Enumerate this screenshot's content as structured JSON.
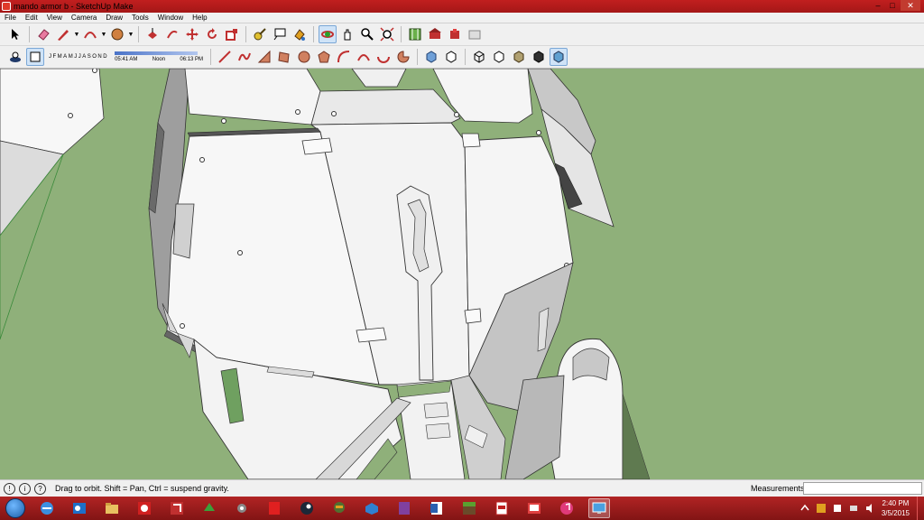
{
  "window": {
    "title": "mando armor b - SketchUp Make",
    "controls": {
      "minimize": "–",
      "maximize": "□",
      "close": "✕"
    }
  },
  "menu": [
    "File",
    "Edit",
    "View",
    "Camera",
    "Draw",
    "Tools",
    "Window",
    "Help"
  ],
  "toolbar1": {
    "tools": [
      "select-icon",
      "eraser-icon",
      "pencil-line-icon",
      "arc-icon",
      "paint-bucket-icon",
      "push-pull-icon",
      "follow-me-icon",
      "move-icon",
      "rotate-icon",
      "scale-icon",
      "tape-measure-icon",
      "text-icon",
      "paint-icon",
      "orbit-icon",
      "pan-icon",
      "zoom-icon",
      "zoom-extents-icon",
      "map-icon",
      "warehouse-icon",
      "extension-icon",
      "share-icon"
    ],
    "active": "orbit-icon"
  },
  "toolbar2": {
    "shadow": {
      "months": [
        "J",
        "F",
        "M",
        "A",
        "M",
        "J",
        "J",
        "A",
        "S",
        "O",
        "N",
        "D"
      ],
      "time_start": "05:41 AM",
      "time_mid": "Noon",
      "time_end": "06:13 PM"
    },
    "styles_active": "shaded-textures-icon"
  },
  "status": {
    "hint": "Drag to orbit. Shift = Pan, Ctrl = suspend gravity.",
    "measurements_label": "Measurements",
    "measurements_value": ""
  },
  "taskbar": {
    "apps": [
      "ie-icon",
      "outlook-icon",
      "explorer-icon",
      "quicken-icon",
      "sketchup-icon",
      "game-icon",
      "settings-icon",
      "acrobat-icon",
      "steam-icon",
      "halo-icon",
      "sketchup-layout-icon",
      "winrar-icon",
      "word-icon",
      "minecraft-icon",
      "pdf-icon",
      "presentation-icon",
      "itunes-icon",
      "display-icon"
    ],
    "clock_time": "2:40 PM",
    "clock_date": "3/5/2015"
  },
  "colors": {
    "taskbar": "#9a1a1a",
    "viewport_bg": "#8fb07a",
    "model_face": "#f2f2f2",
    "model_shadow": "#b4b4b4"
  }
}
